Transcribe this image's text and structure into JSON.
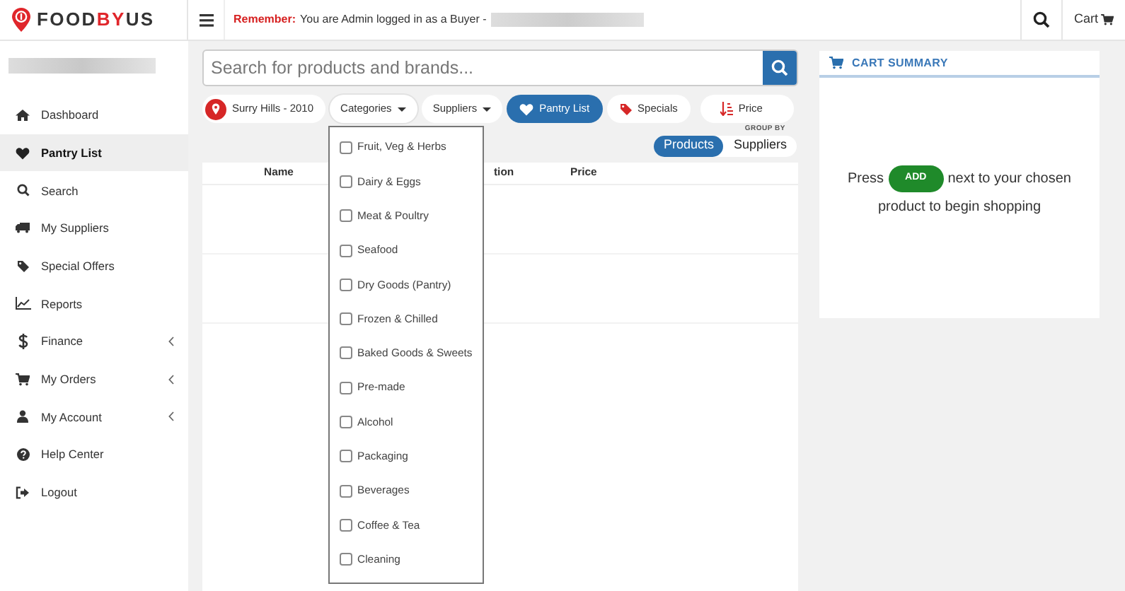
{
  "logo": {
    "parts": [
      {
        "text": "FOOD",
        "color": "#333333"
      },
      {
        "text": "BY",
        "color": "#e0262b"
      },
      {
        "text": "US",
        "color": "#333333"
      }
    ]
  },
  "header": {
    "notice_label": "Remember:",
    "notice_text": "You are Admin logged in as a Buyer -",
    "cart": "Cart"
  },
  "sidebar": {
    "items": [
      {
        "label": "Dashboard",
        "selected": false,
        "expandable": false
      },
      {
        "label": "Pantry List",
        "selected": true,
        "expandable": false
      },
      {
        "label": "Search",
        "selected": false,
        "expandable": false
      },
      {
        "label": "My Suppliers",
        "selected": false,
        "expandable": false
      },
      {
        "label": "Special Offers",
        "selected": false,
        "expandable": false
      },
      {
        "label": "Reports",
        "selected": false,
        "expandable": false
      },
      {
        "label": "Finance",
        "selected": false,
        "expandable": true
      },
      {
        "label": "My Orders",
        "selected": false,
        "expandable": true
      },
      {
        "label": "My Account",
        "selected": false,
        "expandable": true
      },
      {
        "label": "Help Center",
        "selected": false,
        "expandable": false
      },
      {
        "label": "Logout",
        "selected": false,
        "expandable": false
      }
    ]
  },
  "search": {
    "placeholder": "Search for products and brands..."
  },
  "filters": [
    {
      "kind": "location",
      "label": "Surry Hills - 2010",
      "selected": false
    },
    {
      "kind": "dropdown",
      "label": "Categories",
      "expanded": true
    },
    {
      "kind": "dropdown",
      "label": "Suppliers",
      "expanded": false
    },
    {
      "kind": "toggle",
      "label": "Pantry List",
      "selected": true
    },
    {
      "kind": "toggle",
      "label": "Specials",
      "selected": false
    },
    {
      "kind": "sort",
      "label": "Price",
      "selected": false
    }
  ],
  "categories": [
    {
      "label": "Fruit, Veg & Herbs",
      "checked": false
    },
    {
      "label": "Dairy & Eggs",
      "checked": false
    },
    {
      "label": "Meat & Poultry",
      "checked": false
    },
    {
      "label": "Seafood",
      "checked": false
    },
    {
      "label": "Dry Goods (Pantry)",
      "checked": false
    },
    {
      "label": "Frozen & Chilled",
      "checked": false
    },
    {
      "label": "Baked Goods & Sweets",
      "checked": false
    },
    {
      "label": "Pre-made",
      "checked": false
    },
    {
      "label": "Alcohol",
      "checked": false
    },
    {
      "label": "Packaging",
      "checked": false
    },
    {
      "label": "Beverages",
      "checked": false
    },
    {
      "label": "Coffee & Tea",
      "checked": false
    },
    {
      "label": "Cleaning",
      "checked": false
    }
  ],
  "group_by": {
    "label": "GROUP BY",
    "options": [
      {
        "label": "Products",
        "selected": true
      },
      {
        "label": "Suppliers",
        "selected": false
      }
    ]
  },
  "table": {
    "columns": [
      "Name",
      "tion",
      "Price"
    ]
  },
  "cart_summary": {
    "title": "CART SUMMARY",
    "text_before": "Press",
    "button": "ADD",
    "text_after": "next to your chosen",
    "text_end": "product to begin shopping"
  }
}
